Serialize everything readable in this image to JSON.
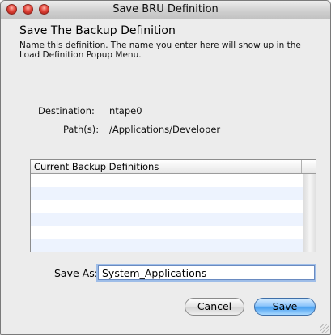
{
  "window": {
    "title": "Save BRU Definition"
  },
  "dialog": {
    "heading": "Save The Backup Definition",
    "description": "Name this definition.  The name you enter here will show up in the Load Definition Popup Menu.",
    "destination_label": "Destination:",
    "destination_value": "ntape0",
    "paths_label": "Path(s):",
    "paths_value": "/Applications/Developer"
  },
  "table": {
    "column_header": "Current Backup Definitions",
    "rows": []
  },
  "save_as": {
    "label": "Save As:",
    "value": "System_Applications"
  },
  "buttons": {
    "cancel_label": "Cancel",
    "save_label": "Save"
  },
  "colors": {
    "close_button": "#e0443a",
    "default_button": "#4ba1f0",
    "row_stripe": "#edf3fe"
  }
}
